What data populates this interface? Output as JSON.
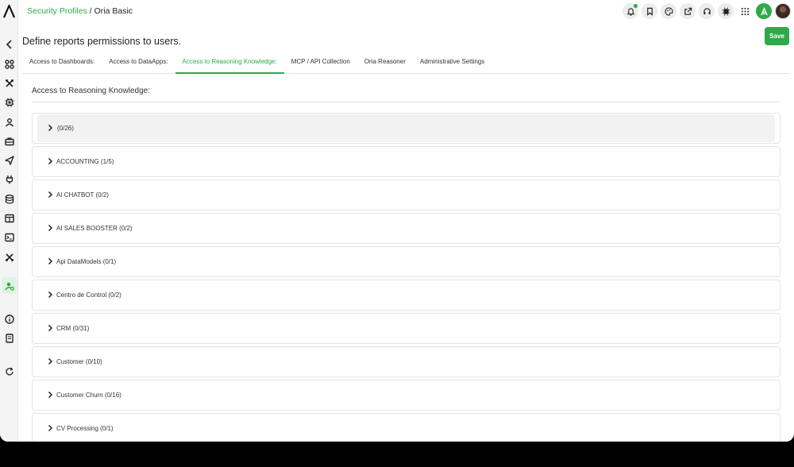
{
  "breadcrumb": {
    "parent": "Security Profiles",
    "separator": "/",
    "current": "Oria Basic"
  },
  "page": {
    "title": "Define reports permissions to users.",
    "save_label": "Save"
  },
  "tabs": [
    {
      "label": "Access to Dashboards:",
      "active": false
    },
    {
      "label": "Access to DataApps:",
      "active": false
    },
    {
      "label": "Access to Reasoning Knowledge:",
      "active": true
    },
    {
      "label": "MCP / API Collection",
      "active": false
    },
    {
      "label": "Oria Reasoner",
      "active": false
    },
    {
      "label": "Administrative Settings",
      "active": false
    }
  ],
  "section": {
    "title": "Access to Reasoning Knowledge:"
  },
  "items": [
    {
      "label": "(0/26)"
    },
    {
      "label": "ACCOUNTING (1/5)"
    },
    {
      "label": "AI CHATBOT (0/2)"
    },
    {
      "label": "AI SALES BOOSTER (0/2)"
    },
    {
      "label": "Api DataModels (0/1)"
    },
    {
      "label": "Centro de Control (0/2)"
    },
    {
      "label": "CRM (0/31)"
    },
    {
      "label": "Customer (0/10)"
    },
    {
      "label": "Customer Churn (0/16)"
    },
    {
      "label": "CV Processing (0/1)"
    }
  ],
  "colors": {
    "accent": "#2eaa4a",
    "sidebar_bg": "#f4f4f4",
    "border": "#e4e4e4"
  },
  "icons": {
    "sidebar": [
      "logo-icon",
      "back-chevron-icon",
      "dashboard-grid-icon",
      "tools-icon",
      "chip-icon",
      "user-network-icon",
      "briefcase-icon",
      "send-icon",
      "plug-icon",
      "database-icon",
      "table-icon",
      "terminal-icon",
      "wrench-icon",
      "user-settings-icon",
      "info-icon",
      "book-icon",
      "refresh-icon"
    ],
    "topbar": [
      "bell-icon",
      "bookmark-icon",
      "palette-icon",
      "share-icon",
      "headset-icon",
      "chip-icon",
      "apps-grid-icon",
      "user-accent-icon",
      "avatar"
    ]
  }
}
